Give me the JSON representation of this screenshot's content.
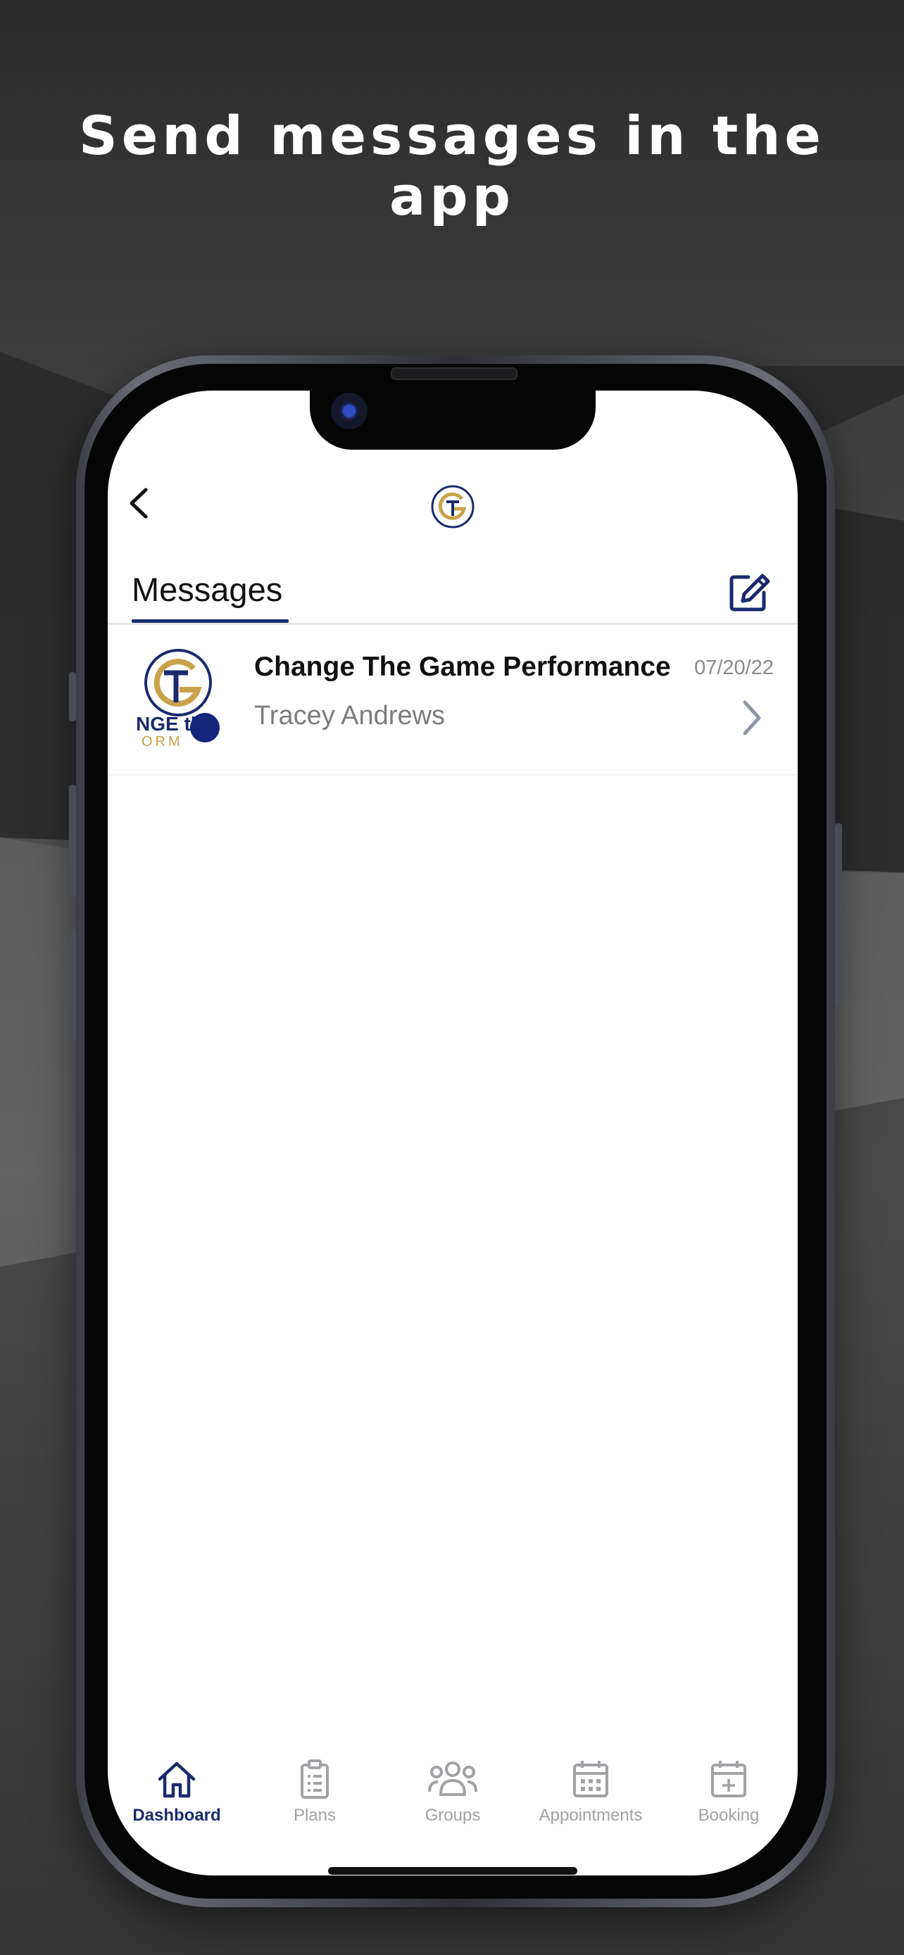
{
  "headline": {
    "line1": "Send messages in the",
    "line2": "app"
  },
  "header": {
    "back_icon": "chevron-left-icon",
    "logo_icon": "ctg-logo-icon"
  },
  "tabs": {
    "messages_label": "Messages",
    "compose_icon": "compose-icon"
  },
  "messages": [
    {
      "title": "Change The Game Performance",
      "date": "07/20/22",
      "sender": "Tracey Andrews",
      "avatar": "ctg-performance-logo",
      "unread": true
    }
  ],
  "tabbar": {
    "items": [
      {
        "label": "Dashboard",
        "icon": "home-icon",
        "active": true
      },
      {
        "label": "Plans",
        "icon": "clipboard-icon",
        "active": false
      },
      {
        "label": "Groups",
        "icon": "groups-icon",
        "active": false
      },
      {
        "label": "Appointments",
        "icon": "calendar-icon",
        "active": false
      },
      {
        "label": "Booking",
        "icon": "calendar-plus-icon",
        "active": false
      }
    ]
  },
  "colors": {
    "accent": "#1a2b6d",
    "gold": "#c9a24a",
    "inactive": "#a2a2a6"
  }
}
